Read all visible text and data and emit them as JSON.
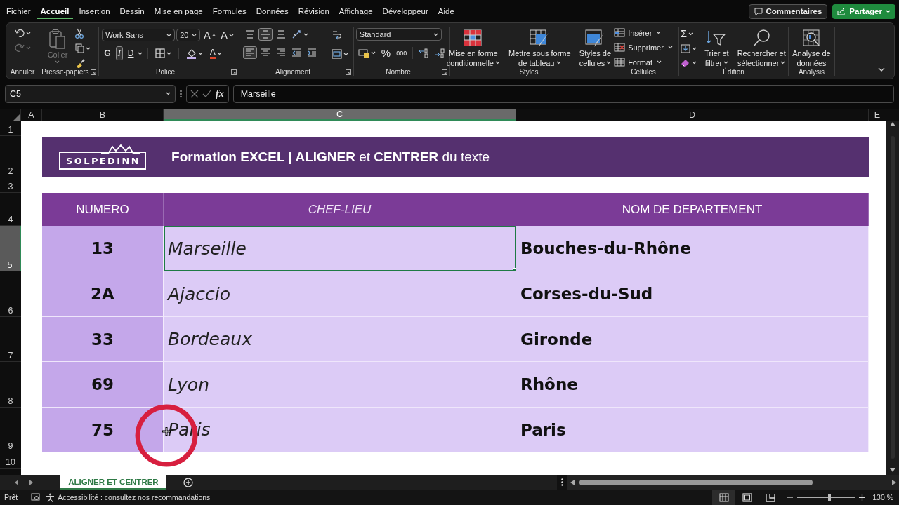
{
  "menu_tabs": [
    {
      "label": "Fichier",
      "selected": false
    },
    {
      "label": "Accueil",
      "selected": true
    },
    {
      "label": "Insertion",
      "selected": false
    },
    {
      "label": "Dessin",
      "selected": false
    },
    {
      "label": "Mise en page",
      "selected": false
    },
    {
      "label": "Formules",
      "selected": false
    },
    {
      "label": "Données",
      "selected": false
    },
    {
      "label": "Révision",
      "selected": false
    },
    {
      "label": "Affichage",
      "selected": false
    },
    {
      "label": "Développeur",
      "selected": false
    },
    {
      "label": "Aide",
      "selected": false
    }
  ],
  "comments_button": "Commentaires",
  "share_button": "Partager",
  "ribbon": {
    "undo": {
      "label": "Annuler",
      "redo_disabled": true
    },
    "clipboard": {
      "label": "Presse-papiers",
      "paste": "Coller",
      "paste_disabled": true
    },
    "font": {
      "label": "Police",
      "font_name": "Work Sans",
      "font_size": "20",
      "grow": "A",
      "shrink": "A",
      "bold": {
        "text": "G",
        "on": false
      },
      "italic": {
        "text": "I",
        "on": true
      },
      "underline": {
        "text": "D",
        "on": false
      },
      "font_color": "A"
    },
    "alignment": {
      "label": "Alignement",
      "vertical": [
        {
          "selected": false
        },
        {
          "selected": true
        },
        {
          "selected": false
        }
      ],
      "horizontal": [
        {
          "selected": true
        },
        {
          "selected": false
        },
        {
          "selected": false
        }
      ]
    },
    "number": {
      "label": "Nombre",
      "format": "Standard",
      "percent": "%",
      "thousands": "000"
    },
    "styles": {
      "label": "Styles",
      "buttons": [
        {
          "lines": [
            "Mise en forme",
            "conditionnelle"
          ]
        },
        {
          "lines": [
            "Mettre sous forme",
            "de tableau"
          ]
        },
        {
          "lines": [
            "Styles de",
            "cellules"
          ]
        }
      ]
    },
    "cells": {
      "label": "Cellules",
      "buttons": [
        "Insérer",
        "Supprimer",
        "Format"
      ]
    },
    "editing": {
      "label": "Édition",
      "sum": "Σ",
      "buttons": [
        {
          "lines": [
            "Trier et",
            "filtrer"
          ]
        },
        {
          "lines": [
            "Rechercher et",
            "sélectionner"
          ]
        }
      ]
    },
    "analysis": {
      "label": "Analysis",
      "buttons": [
        {
          "lines": [
            "Analyse de",
            "données"
          ]
        }
      ]
    }
  },
  "formula_bar": {
    "name_box": "C5",
    "fx": "fx",
    "value": "Marseille"
  },
  "sheet": {
    "columns": [
      {
        "label": "A",
        "selected": false
      },
      {
        "label": "B",
        "selected": false
      },
      {
        "label": "C",
        "selected": true
      },
      {
        "label": "D",
        "selected": false
      },
      {
        "label": "E",
        "selected": false
      }
    ],
    "rows": [
      {
        "label": "1",
        "selected": false
      },
      {
        "label": "2",
        "selected": false
      },
      {
        "label": "3",
        "selected": false
      },
      {
        "label": "4",
        "selected": false
      },
      {
        "label": "5",
        "selected": true
      },
      {
        "label": "6",
        "selected": false
      },
      {
        "label": "7",
        "selected": false
      },
      {
        "label": "8",
        "selected": false
      },
      {
        "label": "9",
        "selected": false
      },
      {
        "label": "10",
        "selected": false
      }
    ],
    "banner": {
      "logo": "SOLPEDINN",
      "title": "**Formation EXCEL | ALIGNER** et **CENTRER** du texte"
    },
    "table": {
      "headers": [
        {
          "text": "NUMERO",
          "kind": "number"
        },
        {
          "text": "CHEF-LIEU",
          "kind": "city"
        },
        {
          "text": "NOM DE DEPARTEMENT",
          "kind": "department"
        }
      ],
      "rows": [
        {
          "cells": [
            {
              "text": "13",
              "selected": false
            },
            {
              "text": "Marseille",
              "selected": true
            },
            {
              "text": "Bouches-du-Rhône",
              "selected": false
            }
          ]
        },
        {
          "cells": [
            {
              "text": "2A",
              "selected": false
            },
            {
              "text": "Ajaccio",
              "selected": false
            },
            {
              "text": "Corses-du-Sud",
              "selected": false
            }
          ]
        },
        {
          "cells": [
            {
              "text": "33",
              "selected": false
            },
            {
              "text": "Bordeaux",
              "selected": false
            },
            {
              "text": "Gironde",
              "selected": false
            }
          ]
        },
        {
          "cells": [
            {
              "text": "69",
              "selected": false
            },
            {
              "text": "Lyon",
              "selected": false
            },
            {
              "text": "Rhône",
              "selected": false
            }
          ]
        },
        {
          "cells": [
            {
              "text": "75",
              "selected": false
            },
            {
              "text": "Paris",
              "selected": false
            },
            {
              "text": "Paris",
              "selected": false
            }
          ]
        }
      ]
    }
  },
  "sheet_tabs": [
    {
      "label": "ALIGNER ET CENTRER",
      "selected": true
    }
  ],
  "status_bar": {
    "ready": "Prêt",
    "accessibility": "Accessibilité : consultez nos recommandations",
    "views": [
      {
        "kind": "normal",
        "selected": true
      },
      {
        "kind": "page_layout",
        "selected": false
      },
      {
        "kind": "page_break",
        "selected": false
      }
    ],
    "zoom": {
      "level": 0.56,
      "reading": "130 %"
    }
  }
}
